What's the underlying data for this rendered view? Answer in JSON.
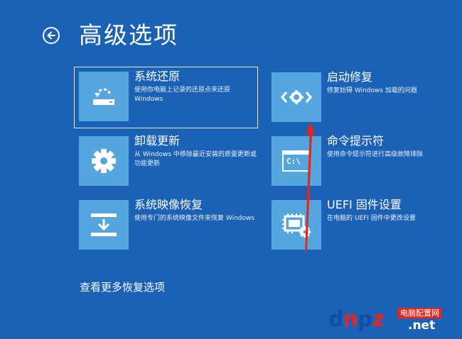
{
  "header": {
    "title": "高级选项",
    "back_icon": "arrow-left-icon"
  },
  "options": [
    {
      "title": "系统还原",
      "desc": "使用你电脑上记录的还原点来还原 Windows",
      "icon": "restore-icon"
    },
    {
      "title": "启动修复",
      "desc": "修复妨碍 Windows 加载的问题",
      "icon": "startup-repair-icon"
    },
    {
      "title": "卸载更新",
      "desc": "从 Windows 中移除最近安装的质量更新或功能更新",
      "icon": "gear-icon"
    },
    {
      "title": "命令提示符",
      "desc": "使用命令提示符进行高级故障排除",
      "icon": "command-prompt-icon",
      "icon_text": "C:\\"
    },
    {
      "title": "系统映像恢复",
      "desc": "使用专门的系统映像文件来恢复 Windows",
      "icon": "system-image-icon"
    },
    {
      "title": "UEFI 固件设置",
      "desc": "在电脑的 UEFI 固件中更改设置",
      "icon": "firmware-settings-icon"
    }
  ],
  "more_link": "查看更多恢复选项",
  "watermark": {
    "logo_d": "d",
    "logo_n": "n",
    "logo_p": "p",
    "logo_z": "z",
    "text_cn": "电脑配置网",
    "text_net": ".net"
  },
  "colors": {
    "background": "#1b62b6",
    "tile": "#55a6df",
    "annotation_arrow": "#e4261f"
  }
}
